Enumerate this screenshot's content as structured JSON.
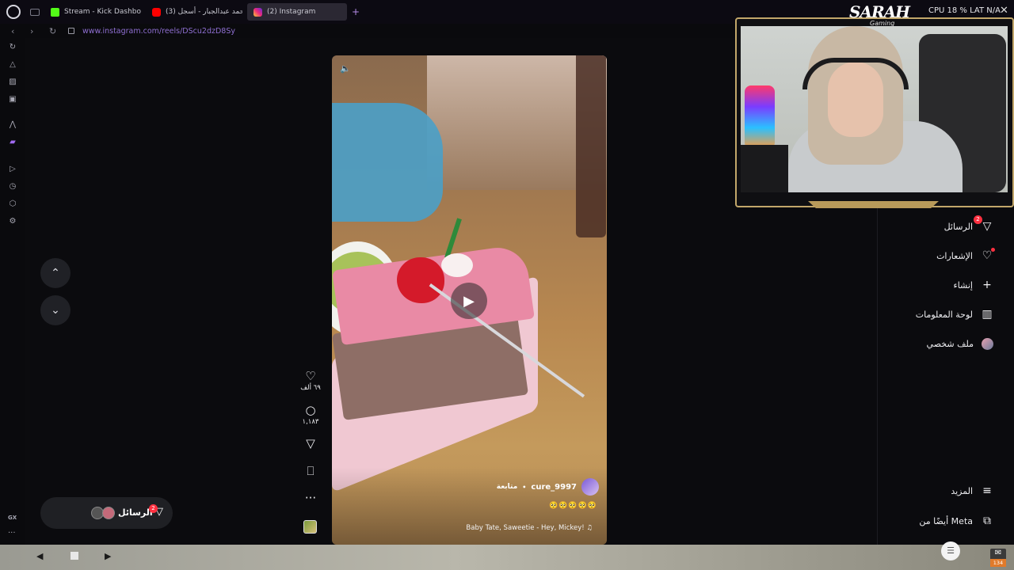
{
  "browser": {
    "tabs": [
      {
        "label": "Stream - Kick Dashboard",
        "active": false
      },
      {
        "label": "(3) محمد عبدالجبار - أسجل",
        "active": false
      },
      {
        "label": "(2) Instagram",
        "active": true
      }
    ],
    "new_tab": "+",
    "url": "www.instagram.com/reels/DScu2dzD8Sy",
    "perf": "CPU 18 %     LAT N/A",
    "close": "✕"
  },
  "sidebar": {
    "icons": [
      "reload-icon",
      "flow-icon",
      "wallet-icon",
      "m-icon",
      "arc-icon",
      "twitch-icon",
      "play-icon",
      "history-icon",
      "extensions-icon",
      "settings-icon"
    ],
    "gx_label": "GX",
    "more": "···"
  },
  "reel": {
    "username": "cure_9997",
    "follow_label": "متابعة",
    "emojis": "🥺🥺🥺🥺🥺",
    "music": "Baby Tate, Saweetie - Hey, Mickey! ♫"
  },
  "actions": {
    "likes": "٦٩ ألف",
    "comments": "١,١٨٣"
  },
  "messages_pill": {
    "label": "الرسائل",
    "badge": "2"
  },
  "right_nav": {
    "items": [
      {
        "label": "الرسائل",
        "icon": "messages-icon",
        "badge": "2"
      },
      {
        "label": "الإشعارات",
        "icon": "heart-icon"
      },
      {
        "label": "إنشاء",
        "icon": "plus-icon"
      },
      {
        "label": "لوحة المعلومات",
        "icon": "dashboard-icon"
      },
      {
        "label": "ملف شخصي",
        "icon": "profile-avatar"
      }
    ],
    "more_label": "المزيد",
    "meta_label": "أيضًا من Meta"
  },
  "stream_overlay": {
    "brand": "SARAH",
    "brand_sub": "Gaming"
  },
  "taskbar": {
    "mail_count": "134"
  },
  "colors": {
    "accent_url": "#8f6fd2",
    "badge_red": "#ff3040",
    "gold_trim": "#c2a76a"
  }
}
